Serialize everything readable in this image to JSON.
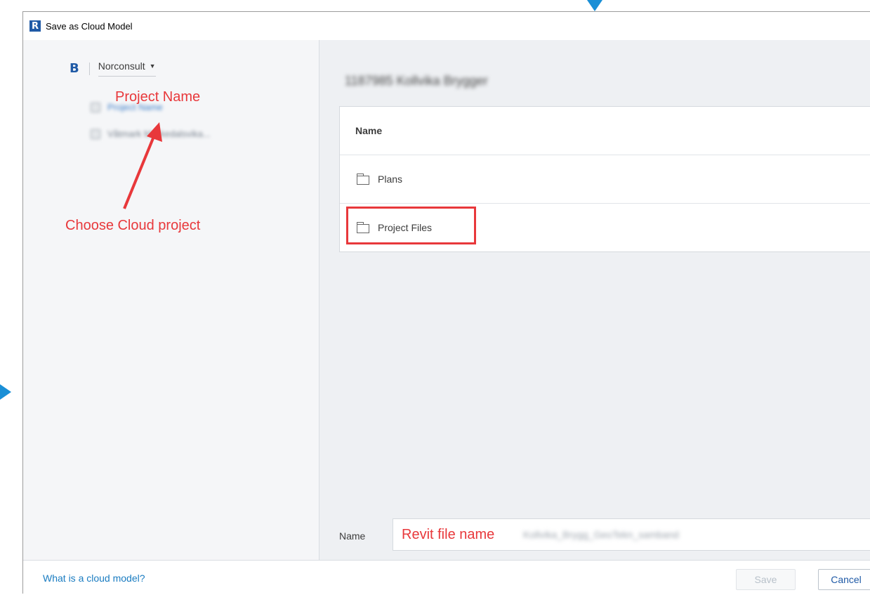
{
  "window": {
    "title": "Save as Cloud Model",
    "app_icon_letter": "R"
  },
  "left_pane": {
    "hub_logo": "B",
    "hub_account": "Norconsult",
    "projects": [
      {
        "label": "Project Name",
        "blurred_text": "Project Name",
        "active": true
      },
      {
        "label": "",
        "blurred_text": "Våtmark Mørkedalsvika...",
        "active": false
      }
    ]
  },
  "annotations": {
    "project_name": "Project Name",
    "choose_cloud_project": "Choose Cloud project",
    "revit_file_name": "Revit file name"
  },
  "right_pane": {
    "breadcrumb": "1187985 Kollvika Brygger",
    "table": {
      "header": "Name",
      "rows": [
        {
          "name": "Plans"
        },
        {
          "name": "Project Files"
        }
      ]
    },
    "name_field": {
      "label": "Name",
      "value": "Revit file name",
      "blurred_suffix": "Kollvika_Brygg_GeoTekn_samband"
    }
  },
  "footer": {
    "help_link": "What is a cloud model?",
    "save_label": "Save",
    "cancel_label": "Cancel"
  },
  "colors": {
    "accent": "#1f5aa6",
    "annotation": "#e8383b",
    "link": "#1a7cc1"
  }
}
